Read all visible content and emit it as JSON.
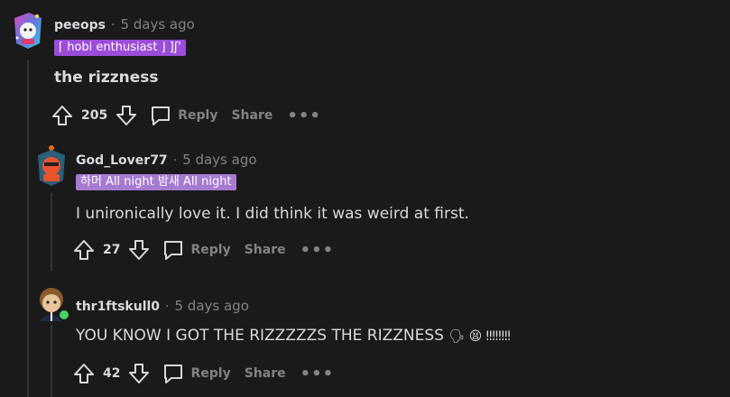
{
  "comments": [
    {
      "username": "peeops",
      "separator": "·",
      "time": "5 days ago",
      "flair": "⌈ hobi enthusiast ⌋   ]ʃ'",
      "flair_color": "#9b4dd9",
      "body": "the rizzness",
      "score": "205",
      "reply_label": "Reply",
      "share_label": "Share",
      "more_label": "•••"
    },
    {
      "username": "God_Lover77",
      "separator": "·",
      "time": "5 days ago",
      "flair": "하머 All night 밤새 All night",
      "flair_color": "#a77ad1",
      "body": "I unironically love it. I did think it was weird at first.",
      "score": "27",
      "reply_label": "Reply",
      "share_label": "Share",
      "more_label": "•••"
    },
    {
      "username": "thr1ftskull0",
      "separator": "·",
      "time": "5 days ago",
      "body": "YOU KNOW I GOT THE RIZZZZZS THE RIZZNESS",
      "emoji_tail": "🗣 😫 ‼‼‼‼",
      "score": "42",
      "reply_label": "Reply",
      "share_label": "Share",
      "more_label": "•••"
    }
  ],
  "icons": [
    "upvote-icon",
    "downvote-icon",
    "reply-bubble-icon",
    "more-options-icon",
    "online-status-dot"
  ],
  "colors": {
    "background": "#1a1a1b",
    "text": "#d7dadc",
    "muted": "#818384",
    "thread_line": "#343536",
    "online": "#46d160"
  }
}
